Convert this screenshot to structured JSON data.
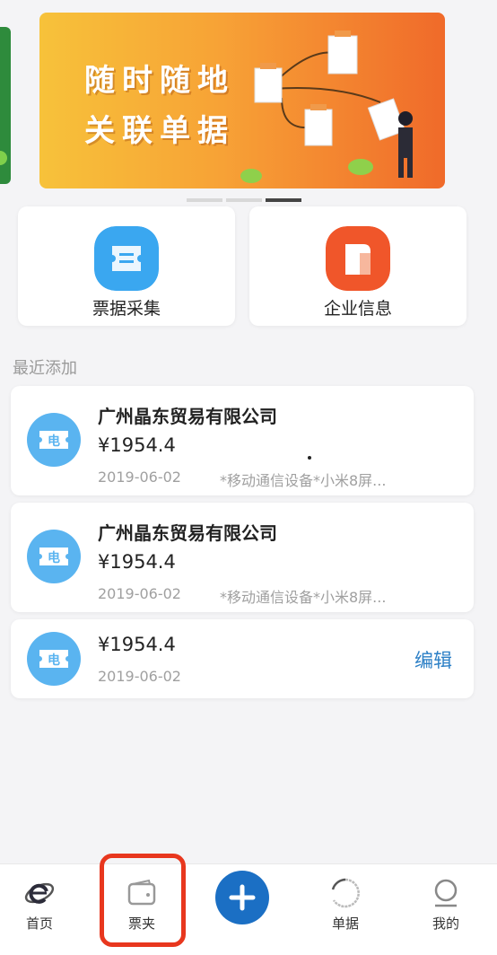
{
  "banner": {
    "line1": "随时随地",
    "line2": "关联单据",
    "slide_count": 3,
    "active_slide": 3
  },
  "actions": [
    {
      "label": "票据采集",
      "icon": "ticket-scan-icon",
      "color": "#3aa7f0"
    },
    {
      "label": "企业信息",
      "icon": "company-building-icon",
      "color": "#f0562a"
    }
  ],
  "recent": {
    "title": "最近添加",
    "items": [
      {
        "icon_text": "电",
        "company": "广州晶东贸易有限公司",
        "amount": "¥1954.4",
        "date": "2019-06-02",
        "desc": "*移动通信设备*小米8屏..."
      },
      {
        "icon_text": "电",
        "company": "广州晶东贸易有限公司",
        "amount": "¥1954.4",
        "date": "2019-06-02",
        "desc": "*移动通信设备*小米8屏..."
      },
      {
        "icon_text": "电",
        "amount": "¥1954.4",
        "date": "2019-06-02",
        "action": "编辑"
      }
    ]
  },
  "nav": {
    "items": [
      {
        "label": "首页",
        "icon": "home-e-icon"
      },
      {
        "label": "票夹",
        "icon": "wallet-icon"
      },
      {
        "label": "",
        "icon": "plus-icon"
      },
      {
        "label": "单据",
        "icon": "loading-ring-icon"
      },
      {
        "label": "我的",
        "icon": "profile-icon"
      }
    ],
    "highlighted": "票夹"
  },
  "colors": {
    "accent": "#1b6fc4",
    "ticket": "#5ab4f0",
    "highlight_box": "#e8371e"
  }
}
